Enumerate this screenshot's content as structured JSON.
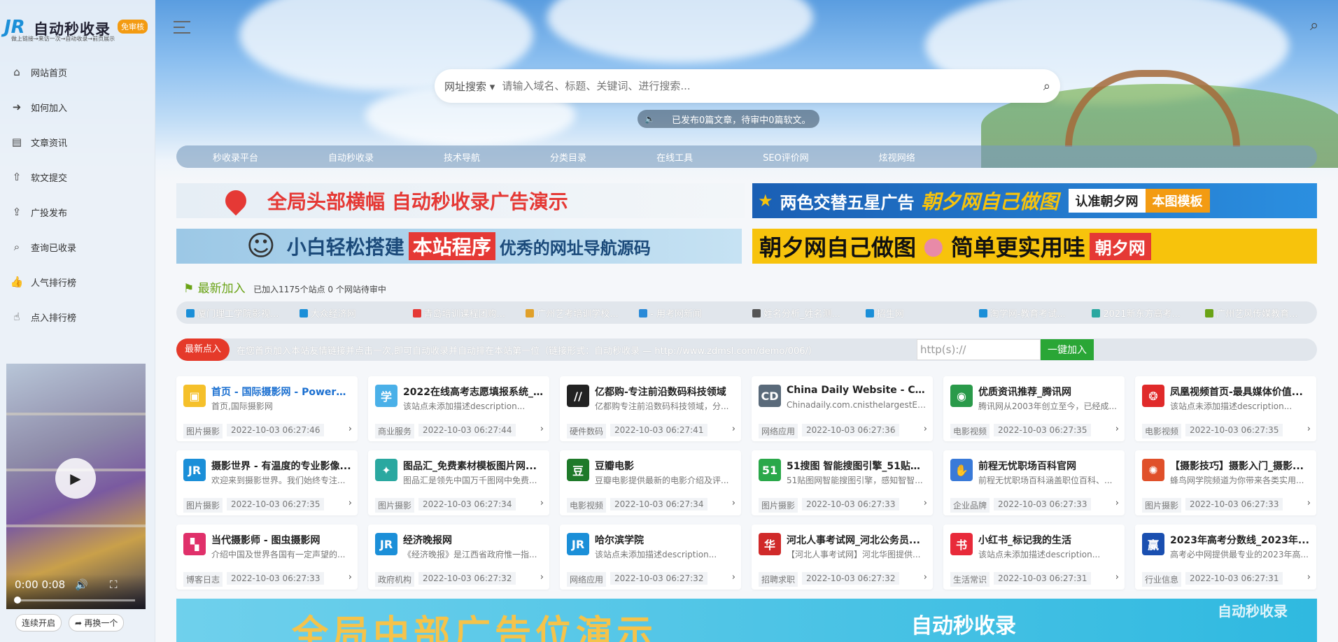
{
  "brand": {
    "mark": "JR",
    "name": "自动秒收录",
    "badge": "免审核",
    "slogan": "做上链接→来访一次→自动收录→前页展示"
  },
  "sidebar": {
    "items": [
      {
        "label": "网站首页",
        "icon": "home-icon",
        "glyph": "⌂"
      },
      {
        "label": "如何加入",
        "icon": "arrow-circle-icon",
        "glyph": "➜"
      },
      {
        "label": "文章资讯",
        "icon": "book-icon",
        "glyph": "▤"
      },
      {
        "label": "软文提交",
        "icon": "upload-circle-icon",
        "glyph": "⇧"
      },
      {
        "label": "广投发布",
        "icon": "share-icon",
        "glyph": "⇪"
      },
      {
        "label": "查询已收录",
        "icon": "search-icon",
        "glyph": "⌕"
      },
      {
        "label": "人气排行榜",
        "icon": "thumbs-up-icon",
        "glyph": "👍"
      },
      {
        "label": "点入排行榜",
        "icon": "pointer-icon",
        "glyph": "☝"
      }
    ]
  },
  "video": {
    "time": "0:00 0:08",
    "progress": 0.0
  },
  "video_buttons": {
    "autoplay": "连续开启",
    "next": "再换一个"
  },
  "search": {
    "type": "网址搜索",
    "placeholder": "请输入域名、标题、关键词、进行搜索..."
  },
  "notice": "已发布0篇文章，待审中0篇软文。",
  "mainnav": [
    "秒收录平台",
    "自动秒收录",
    "技术导航",
    "分类目录",
    "在线工具",
    "SEO评价网",
    "炫视网络"
  ],
  "banners": {
    "b1": "全局头部横幅 自动秒收录广告演示",
    "b2": {
      "a": "两色交替五星广告",
      "b": "朝夕网自己做图",
      "c": "认准朝夕网",
      "d": "本图模板"
    },
    "b3": {
      "a": "小白轻松搭建",
      "b": "本站程序",
      "c": "优秀的网址导航源码"
    },
    "b4": {
      "a": "朝夕网自己做图",
      "b": "简单更实用哇",
      "c": "朝夕网"
    }
  },
  "latest": {
    "title": "最新加入",
    "stats": "已加入1175个站点 0 个网站待审中",
    "items": [
      "厦门理工学院影视...",
      "大众经济网",
      "青岛培训课程团购...",
      "广州艺考培训学校...",
      "- 用考网新闻",
      "姓名分析_姓名测...",
      "招生网",
      "淘学网-教育考试...",
      "2021新东方高考...",
      "广州艺风传媒教育..."
    ]
  },
  "submit": {
    "label": "最新点入",
    "tip": "在您首页加入本站友情链接并点击一次,即可自动收录并自动排在本站第一位（链接形式：自动秒收录 — http://www.zdmsl.com/demo/006/）",
    "input_value": "http(s)://",
    "button": "一键加入"
  },
  "cards": [
    {
      "title": "首页 - 国际摄影网 - Powere...",
      "desc": "首页,国际摄影网",
      "cat": "图片摄影",
      "time": "2022-10-03 06:27:46",
      "color": "#f5c02a",
      "glyph": "▣",
      "title_color": "#1a6fd0"
    },
    {
      "title": "2022在线高考志愿填报系统_...",
      "desc": "该站点未添加描述description...",
      "cat": "商业服务",
      "time": "2022-10-03 06:27:44",
      "color": "#4ab0e8",
      "glyph": "学"
    },
    {
      "title": "亿都购-专注前沿数码科技领域",
      "desc": "亿都购专注前沿数码科技领域，分...",
      "cat": "硬件数码",
      "time": "2022-10-03 06:27:41",
      "color": "#222222",
      "glyph": "//"
    },
    {
      "title": "China Daily Website - Con...",
      "desc": "Chinadaily.com.cnisthelargestEn...",
      "cat": "网络应用",
      "time": "2022-10-03 06:27:36",
      "color": "#5a6a7a",
      "glyph": "CD"
    },
    {
      "title": "优质资讯推荐_腾讯网",
      "desc": "腾讯网从2003年创立至今，已经成...",
      "cat": "电影视频",
      "time": "2022-10-03 06:27:35",
      "color": "#2a9a4a",
      "glyph": "◉"
    },
    {
      "title": "凤凰视频首页-最具媒体价值...",
      "desc": "该站点未添加描述description...",
      "cat": "电影视频",
      "time": "2022-10-03 06:27:35",
      "color": "#e02a2a",
      "glyph": "❂"
    },
    {
      "title": "摄影世界 - 有温度的专业影像...",
      "desc": "欢迎来到摄影世界。我们始终专注...",
      "cat": "图片摄影",
      "time": "2022-10-03 06:27:35",
      "color": "#1b8fd8",
      "glyph": "JR"
    },
    {
      "title": "图品汇_免费素材模板图片网...",
      "desc": "图品汇是领先中国万千图网中免费...",
      "cat": "图片摄影",
      "time": "2022-10-03 06:27:34",
      "color": "#2aa8a0",
      "glyph": "✦"
    },
    {
      "title": "豆瓣电影",
      "desc": "豆瓣电影提供最新的电影介绍及评...",
      "cat": "电影视频",
      "time": "2022-10-03 06:27:34",
      "color": "#1f7a2a",
      "glyph": "豆"
    },
    {
      "title": "51搜图 智能搜图引擎_51贴图网",
      "desc": "51贴图网智能搜图引擎，感知智智...",
      "cat": "图片摄影",
      "time": "2022-10-03 06:27:33",
      "color": "#2aa84a",
      "glyph": "51"
    },
    {
      "title": "前程无忧职场百科官网",
      "desc": "前程无忧职场百科涵盖职位百科、...",
      "cat": "企业品牌",
      "time": "2022-10-03 06:27:33",
      "color": "#3a7ad8",
      "glyph": "✋"
    },
    {
      "title": "【摄影技巧】摄影入门_摄影...",
      "desc": "蜂鸟网学院频道为你带来各类实用...",
      "cat": "图片摄影",
      "time": "2022-10-03 06:27:33",
      "color": "#e0502a",
      "glyph": "✺"
    },
    {
      "title": "当代摄影师 - 图虫摄影网",
      "desc": "介绍中国及世界各国有一定声望的...",
      "cat": "博客日志",
      "time": "2022-10-03 06:27:33",
      "color": "#e0306a",
      "glyph": "▚"
    },
    {
      "title": "经济晚报网",
      "desc": "《经济晚报》是江西省政府惟一指...",
      "cat": "政府机构",
      "time": "2022-10-03 06:27:32",
      "color": "#1b8fd8",
      "glyph": "JR"
    },
    {
      "title": "哈尔滨学院",
      "desc": "该站点未添加描述description...",
      "cat": "网络应用",
      "time": "2022-10-03 06:27:32",
      "color": "#1b8fd8",
      "glyph": "JR"
    },
    {
      "title": "河北人事考试网_河北公务员...",
      "desc": "【河北人事考试网】河北华图提供...",
      "cat": "招聘求职",
      "time": "2022-10-03 06:27:32",
      "color": "#d02a2a",
      "glyph": "华"
    },
    {
      "title": "小红书_标记我的生活",
      "desc": "该站点未添加描述description...",
      "cat": "生活常识",
      "time": "2022-10-03 06:27:31",
      "color": "#e82a3a",
      "glyph": "书"
    },
    {
      "title": "2023年高考分数线_2023年...",
      "desc": "高考必中网提供最专业的2023年高...",
      "cat": "行业信息",
      "time": "2022-10-03 06:27:31",
      "color": "#1a4fb0",
      "glyph": "赢"
    }
  ],
  "bottom_banner": {
    "text": "全局中部广告位演示",
    "sub": "自动秒收录"
  },
  "watermark": "自动秒收录"
}
